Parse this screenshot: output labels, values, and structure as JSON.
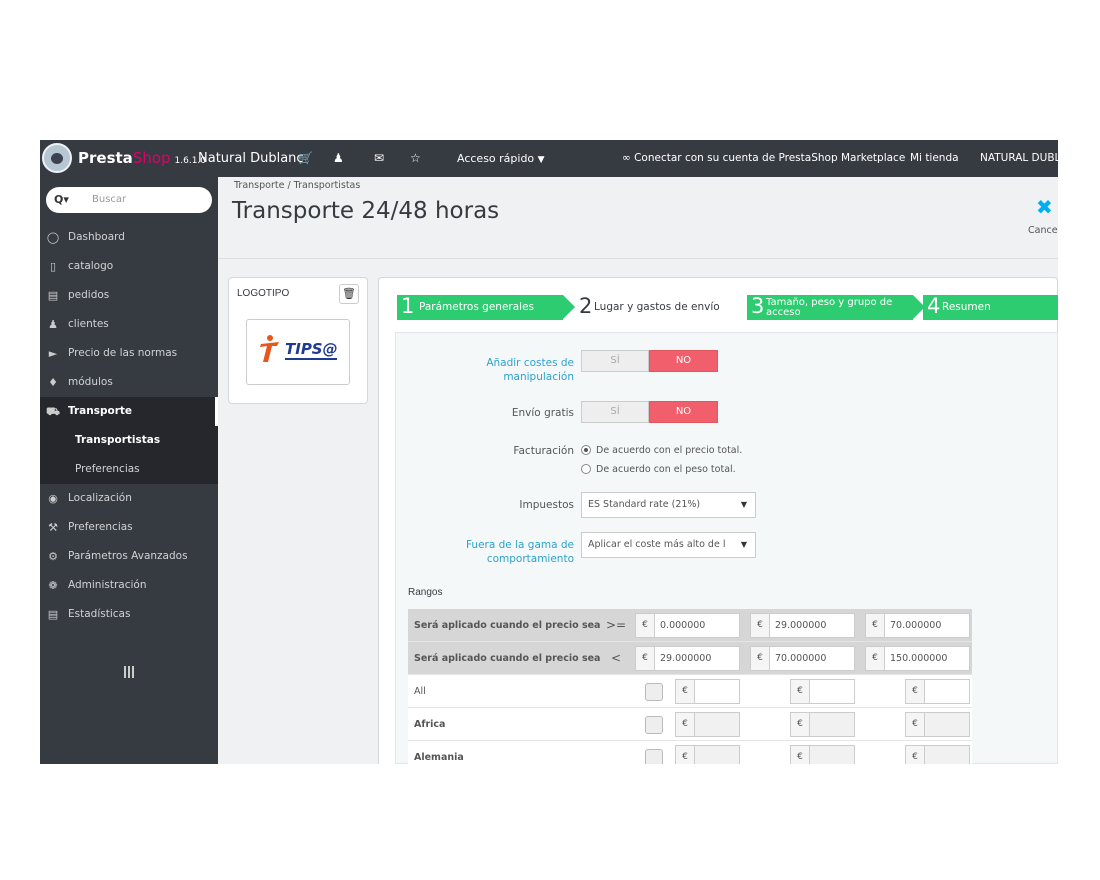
{
  "topbar": {
    "brand_main": "Presta",
    "brand_shop": "Shop",
    "version": "1.6.1.0",
    "store_name": "Natural Dublanc",
    "icons": [
      "cart-icon",
      "user-icon",
      "mail-icon",
      "trophy-icon"
    ],
    "quick_access": "Acceso rápido",
    "marketplace": "Conectar con su cuenta de PrestaShop Marketplace",
    "my_store": "Mi tienda",
    "account": "NATURAL DUBL"
  },
  "sidebar": {
    "search_placeholder": "Buscar",
    "items": [
      {
        "label": "Dashboard",
        "icon": "dashboard-icon"
      },
      {
        "label": "catalogo",
        "icon": "book-icon"
      },
      {
        "label": "pedidos",
        "icon": "credit-card-icon"
      },
      {
        "label": "clientes",
        "icon": "users-icon"
      },
      {
        "label": "Precio de las normas",
        "icon": "tag-icon"
      },
      {
        "label": "módulos",
        "icon": "puzzle-icon"
      },
      {
        "label": "Transporte",
        "icon": "truck-icon"
      },
      {
        "label": "Transportistas",
        "icon": ""
      },
      {
        "label": "Preferencias",
        "icon": ""
      },
      {
        "label": "Localización",
        "icon": "globe-icon"
      },
      {
        "label": "Preferencias",
        "icon": "wrench-icon"
      },
      {
        "label": "Parámetros Avanzados",
        "icon": "cogs-icon"
      },
      {
        "label": "Administración",
        "icon": "cog-icon"
      },
      {
        "label": "Estadísticas",
        "icon": "bar-chart-icon"
      }
    ]
  },
  "header": {
    "breadcrumb": "Transporte  /  Transportistas",
    "title": "Transporte 24/48 horas",
    "cancel_label": "Cance"
  },
  "logo_panel": {
    "label": "LOGOTIPO",
    "logo_text": "TIPS@"
  },
  "wizard": {
    "steps": [
      {
        "num": "1",
        "label": "Parámetros generales"
      },
      {
        "num": "2",
        "label": "Lugar y gastos de envío"
      },
      {
        "num": "3",
        "label1": "Tamaño, peso y grupo de",
        "label2": "acceso"
      },
      {
        "num": "4",
        "label": "Resumen"
      }
    ]
  },
  "form": {
    "handling_label_1": "Añadir costes de",
    "handling_label_2": "manipulación",
    "free_label": "Envío gratis",
    "yes": "SÍ",
    "no": "NO",
    "billing_label": "Facturación",
    "billing_opt1": "De acuerdo con el precio total.",
    "billing_opt2": "De acuerdo con el peso total.",
    "tax_label": "Impuestos",
    "tax_value": "ES Standard rate (21%)",
    "range_label_1": "Fuera de la gama de",
    "range_label_2": "comportamiento",
    "range_value": "Aplicar el coste más alto de l"
  },
  "ranges": {
    "title": "Rangos",
    "currency": "€",
    "rows": [
      {
        "label": "Será aplicado cuando el precio sea",
        "op": ">=",
        "values": [
          "0.000000",
          "29.000000",
          "70.000000"
        ]
      },
      {
        "label": "Será aplicado cuando el precio sea",
        "op": "<",
        "values": [
          "29.000000",
          "70.000000",
          "150.000000"
        ]
      },
      {
        "label": "All",
        "values": [
          "",
          "",
          ""
        ]
      },
      {
        "label": "Africa",
        "values": [
          "",
          "",
          ""
        ]
      },
      {
        "label": "Alemania",
        "values": [
          "",
          "",
          ""
        ]
      }
    ]
  }
}
